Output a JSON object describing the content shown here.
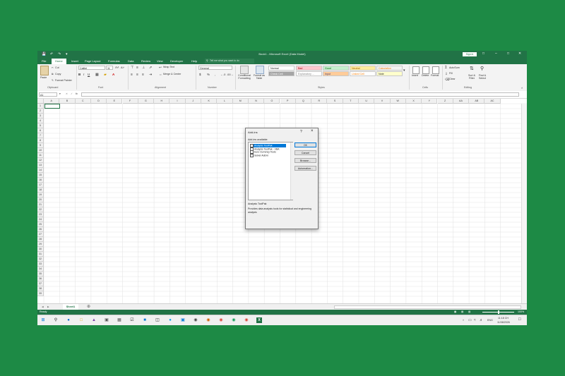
{
  "title_bar": {
    "title": "Book1 - Microsoft Excel (Data Model)",
    "sign_in": "Sign in"
  },
  "tabs": [
    "File",
    "Home",
    "Insert",
    "Page Layout",
    "Formulas",
    "Data",
    "Review",
    "View",
    "Developer",
    "Help"
  ],
  "search": {
    "placeholder": "Tell me what you want to do"
  },
  "ribbon": {
    "clipboard": {
      "paste": "Paste",
      "cut": "Cut",
      "copy": "Copy",
      "format_painter": "Format Painter",
      "label": "Clipboard"
    },
    "font": {
      "name": "Calibri",
      "size": "11",
      "label": "Font"
    },
    "alignment": {
      "wrap": "Wrap Text",
      "merge": "Merge & Center",
      "label": "Alignment"
    },
    "number": {
      "format": "General",
      "label": "Number"
    },
    "styles": {
      "conditional": "Conditional Formatting",
      "format_table": "Format as Table",
      "cells": [
        {
          "text": "Normal",
          "bg": "#ffffff",
          "fg": "#222222"
        },
        {
          "text": "Bad",
          "bg": "#ffc7ce",
          "fg": "#9c0006"
        },
        {
          "text": "Good",
          "bg": "#c6efce",
          "fg": "#006100"
        },
        {
          "text": "Neutral",
          "bg": "#ffeb9c",
          "fg": "#9c5700"
        },
        {
          "text": "Calculation",
          "bg": "#f2f2f2",
          "fg": "#fa7d00"
        },
        {
          "text": "Check Cell",
          "bg": "#a5a5a5",
          "fg": "#ffffff"
        },
        {
          "text": "Explanatory ...",
          "bg": "#ffffff",
          "fg": "#7f7f7f"
        },
        {
          "text": "Input",
          "bg": "#ffcc99",
          "fg": "#3f3f76"
        },
        {
          "text": "Linked Cell",
          "bg": "#ffffff",
          "fg": "#fa7d00"
        },
        {
          "text": "Note",
          "bg": "#ffffcc",
          "fg": "#222222"
        }
      ],
      "label": "Styles"
    },
    "cells": {
      "insert": "Insert",
      "delete": "Delete",
      "format": "Format",
      "label": "Cells"
    },
    "editing": {
      "autosum": "AutoSum",
      "fill": "Fill",
      "clear": "Clear",
      "sort": "Sort & Filter",
      "find": "Find & Select",
      "label": "Editing"
    }
  },
  "formula_bar": {
    "name_box": "A1",
    "fx": "fx"
  },
  "columns": [
    "A",
    "B",
    "C",
    "D",
    "E",
    "F",
    "G",
    "H",
    "I",
    "J",
    "K",
    "L",
    "M",
    "N",
    "O",
    "P",
    "Q",
    "R",
    "S",
    "T",
    "U",
    "V",
    "W",
    "X",
    "Y",
    "Z",
    "AA",
    "AB",
    "AC"
  ],
  "rows": [
    "1",
    "2",
    "3",
    "4",
    "5",
    "6",
    "7",
    "8",
    "9",
    "10",
    "11",
    "12",
    "13",
    "14",
    "15",
    "16",
    "17",
    "18",
    "19",
    "20",
    "21",
    "22",
    "23",
    "24",
    "25",
    "26",
    "27",
    "28",
    "29",
    "30",
    "31",
    "32",
    "33",
    "34",
    "35",
    "36",
    "37",
    "38",
    "39"
  ],
  "sheet_tab": "Sheet1",
  "status": {
    "ready": "Ready",
    "zoom": "100%"
  },
  "dialog": {
    "title": "Add-ins",
    "help": "?",
    "list_label": "Add-ins available:",
    "items": [
      "Analysis ToolPak",
      "Analysis ToolPak - VBA",
      "Euro Currency Tools",
      "Solver Add-in"
    ],
    "buttons": [
      "OK",
      "Cancel",
      "Browse...",
      "Automation..."
    ],
    "desc_title": "Analysis ToolPak",
    "desc_text": "Provides data analysis tools for statistical and engineering analysis"
  },
  "taskbar": {
    "time": "11:18 CH",
    "date": "11/08/2026",
    "lang": "ENG"
  }
}
